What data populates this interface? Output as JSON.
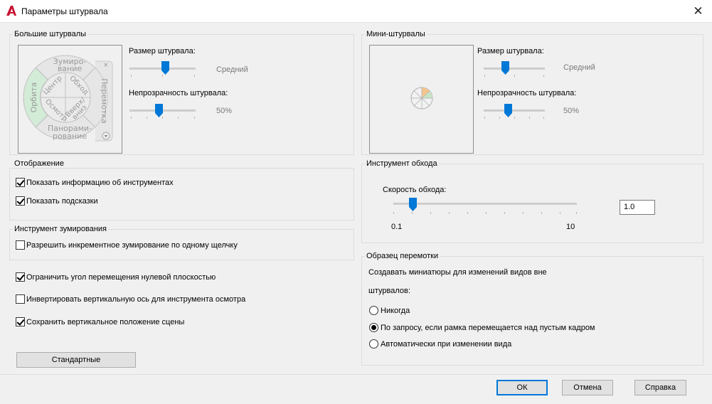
{
  "window": {
    "title": "Параметры штурвала",
    "close_glyph": "✕"
  },
  "big_wheels": {
    "title": "Большие штурвалы",
    "size_label": "Размер штурвала:",
    "size_value": "Средний",
    "size_level": 0.33,
    "opacity_label": "Непрозрачность штурвала:",
    "opacity_value": "50%",
    "opacity_level": 0.4,
    "wheel": {
      "outer_top": [
        "Зумиро-",
        "вание"
      ],
      "outer_left": "Орбита",
      "outer_right": "Перемотка",
      "outer_bottom": [
        "Панорами-",
        "рование"
      ],
      "inner_center": "Центр",
      "inner_walk": "Обход",
      "inner_look": "Осмотр",
      "inner_up": [
        "Вверх/",
        "вниз"
      ]
    }
  },
  "mini_wheels": {
    "title": "Мини-штурвалы",
    "size_label": "Размер штурвала:",
    "size_value": "Средний",
    "size_level": 0.33,
    "opacity_label": "Непрозрачность штурвала:",
    "opacity_value": "50%",
    "opacity_level": 0.4
  },
  "display": {
    "title": "Отображение",
    "show_tool_info": {
      "label": "Показать информацию об инструментах",
      "checked": true
    },
    "show_tooltips": {
      "label": "Показать подсказки",
      "checked": true
    }
  },
  "zoom_tool": {
    "title": "Инструмент зумирования",
    "incremental": {
      "label": "Разрешить инкрементное зумирование по одному щелчку",
      "checked": false
    }
  },
  "options": {
    "limit_angle": {
      "label": "Ограничить угол перемещения нулевой плоскостью",
      "checked": true
    },
    "invert_axis": {
      "label": "Инвертировать вертикальную ось для инструмента осмотра",
      "checked": false
    },
    "keep_upright": {
      "label": "Сохранить вертикальное положение сцены",
      "checked": true
    }
  },
  "defaults_button": "Стандартные",
  "walk_tool": {
    "title": "Инструмент обхода",
    "speed_label": "Скорость обхода:",
    "min_label": "0.1",
    "max_label": "10",
    "speed_value": "1.0",
    "speed_level": 0.1
  },
  "rewind": {
    "title": "Образец перемотки",
    "description_line1": "Создавать миниатюры для изменений видов вне",
    "description_line2": "штурвалов:",
    "options": [
      {
        "label": "Никогда",
        "selected": false
      },
      {
        "label": "По запросу, если рамка перемещается над пустым кадром",
        "selected": true
      },
      {
        "label": "Автоматически при изменении вида",
        "selected": false
      }
    ]
  },
  "buttons": {
    "ok": "ОК",
    "cancel": "Отмена",
    "help": "Справка"
  },
  "colors": {
    "accent": "#0078d7",
    "app_icon": "#c8102e"
  }
}
